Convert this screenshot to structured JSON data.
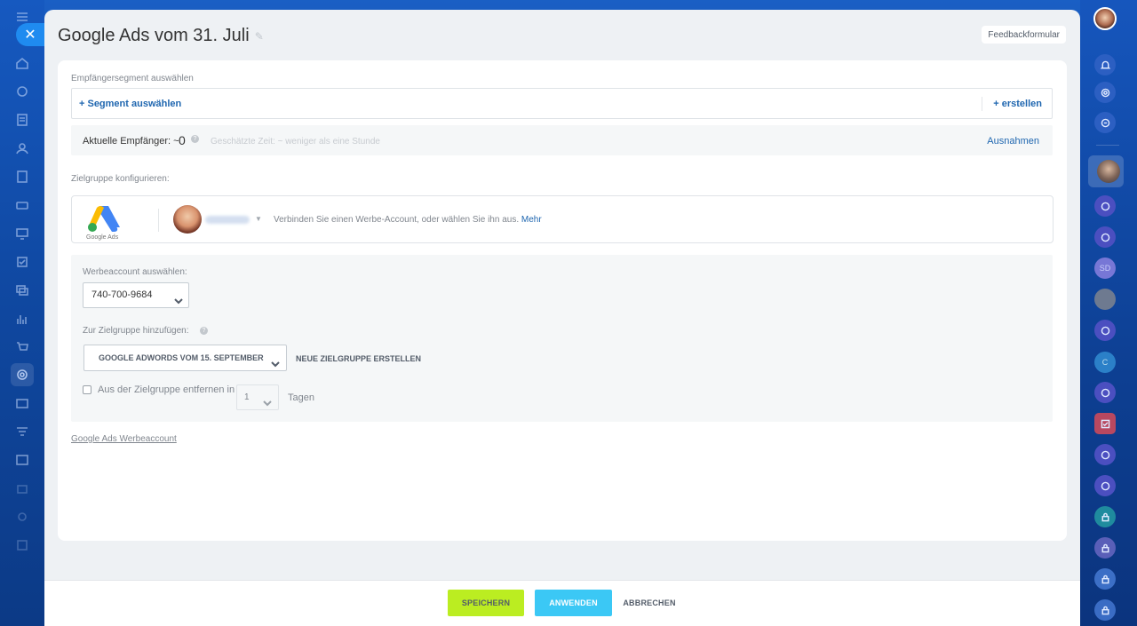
{
  "page": {
    "title": "Google Ads vom 31. Juli",
    "feedback_label": "Feedbackformular"
  },
  "segment": {
    "section_label": "Empfängersegment auswählen",
    "select_label": "+ Segment auswählen",
    "create_label": "+ erstellen"
  },
  "recipients": {
    "label": "Aktuelle Empfänger: ~",
    "count": "0",
    "estimated_time": "Geschätzte Zeit: ~ weniger als eine Stunde",
    "exceptions_label": "Ausnahmen"
  },
  "audience": {
    "section_label": "Zielgruppe konfigurieren:",
    "logo_text": "Google Ads",
    "hint": "Verbinden Sie einen Werbe-Account, oder wählen Sie ihn aus.",
    "more_link": "Mehr"
  },
  "settings": {
    "account_label": "Werbeaccount auswählen:",
    "account_value": "740-700-9684",
    "add_label": "Zur Zielgruppe hinzufügen:",
    "audience_value": "GOOGLE ADWORDS VOM 15. SEPTEMBER",
    "new_audience": "NEUE ZIELGRUPPE ERSTELLEN",
    "remove_label": "Aus der Zielgruppe entfernen in",
    "days_value": "1",
    "days_label": "Tagen"
  },
  "links": {
    "ads_account": "Google Ads Werbeaccount"
  },
  "footer": {
    "save": "SPEICHERN",
    "apply": "ANWENDEN",
    "cancel": "ABBRECHEN"
  },
  "right_sidebar": {
    "avatar_initials_sd": "SD",
    "avatar_initial_c": "C"
  },
  "colors": {
    "accent_blue": "#2067b0",
    "save_green": "#bbed21",
    "apply_cyan": "#3bc8f5"
  }
}
